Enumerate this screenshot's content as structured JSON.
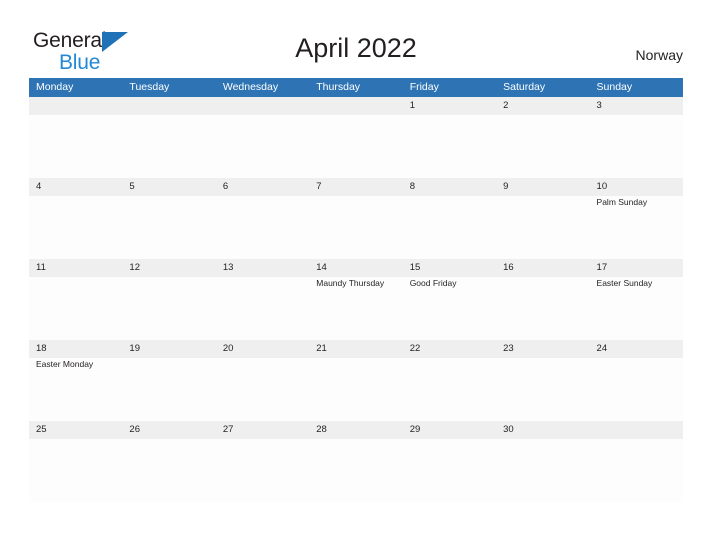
{
  "brand": {
    "name_part1": "General",
    "name_part2": "Blue"
  },
  "header": {
    "title": "April 2022",
    "country": "Norway"
  },
  "calendar": {
    "weekday_headers": [
      "Monday",
      "Tuesday",
      "Wednesday",
      "Thursday",
      "Friday",
      "Saturday",
      "Sunday"
    ],
    "accent_color": "#2e74b5",
    "band_color": "#efefef",
    "weeks": [
      [
        {
          "num": "",
          "event": ""
        },
        {
          "num": "",
          "event": ""
        },
        {
          "num": "",
          "event": ""
        },
        {
          "num": "",
          "event": ""
        },
        {
          "num": "1",
          "event": ""
        },
        {
          "num": "2",
          "event": ""
        },
        {
          "num": "3",
          "event": ""
        }
      ],
      [
        {
          "num": "4",
          "event": ""
        },
        {
          "num": "5",
          "event": ""
        },
        {
          "num": "6",
          "event": ""
        },
        {
          "num": "7",
          "event": ""
        },
        {
          "num": "8",
          "event": ""
        },
        {
          "num": "9",
          "event": ""
        },
        {
          "num": "10",
          "event": "Palm Sunday"
        }
      ],
      [
        {
          "num": "11",
          "event": ""
        },
        {
          "num": "12",
          "event": ""
        },
        {
          "num": "13",
          "event": ""
        },
        {
          "num": "14",
          "event": "Maundy Thursday"
        },
        {
          "num": "15",
          "event": "Good Friday"
        },
        {
          "num": "16",
          "event": ""
        },
        {
          "num": "17",
          "event": "Easter Sunday"
        }
      ],
      [
        {
          "num": "18",
          "event": "Easter Monday"
        },
        {
          "num": "19",
          "event": ""
        },
        {
          "num": "20",
          "event": ""
        },
        {
          "num": "21",
          "event": ""
        },
        {
          "num": "22",
          "event": ""
        },
        {
          "num": "23",
          "event": ""
        },
        {
          "num": "24",
          "event": ""
        }
      ],
      [
        {
          "num": "25",
          "event": ""
        },
        {
          "num": "26",
          "event": ""
        },
        {
          "num": "27",
          "event": ""
        },
        {
          "num": "28",
          "event": ""
        },
        {
          "num": "29",
          "event": ""
        },
        {
          "num": "30",
          "event": ""
        },
        {
          "num": "",
          "event": ""
        }
      ]
    ]
  }
}
